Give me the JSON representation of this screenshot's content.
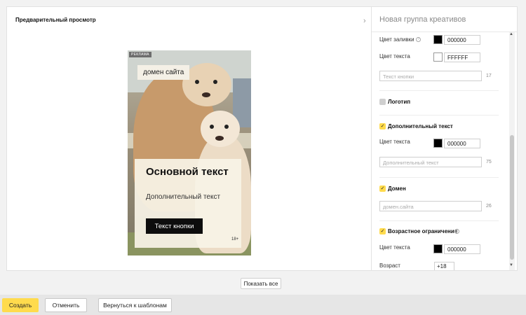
{
  "preview": {
    "title": "Предварительный просмотр",
    "collapse_icon": "chevron-right-icon",
    "ad": {
      "badge": "РЕКЛАМА",
      "domain": "домен сайта",
      "main_text": "Основной текст",
      "extra_text": "Дополнительный текст",
      "button_text": "Текст кнопки",
      "age": "18+"
    },
    "show_all": "Показать все"
  },
  "settings": {
    "title": "Новая группа креативов",
    "fill_color": {
      "label": "Цвет заливки",
      "value": "000000",
      "swatch": "#000000"
    },
    "text_color": {
      "label": "Цвет текста",
      "value": "FFFFFF",
      "swatch": "#ffffff"
    },
    "button_text": {
      "placeholder": "Текст кнопки",
      "counter": "17"
    },
    "logo": {
      "label": "Логотип",
      "checked": false
    },
    "extra_text": {
      "label": "Дополнительный текст",
      "checked": true,
      "color_label": "Цвет текста",
      "color_value": "000000",
      "swatch": "#000000",
      "placeholder": "Дополнительный текст",
      "counter": "75"
    },
    "domain": {
      "label": "Домен",
      "checked": true,
      "placeholder": "домен.сайта",
      "counter": "26"
    },
    "age_limit": {
      "label": "Возрастное ограничение",
      "checked": true,
      "color_label": "Цвет текста",
      "color_value": "000000",
      "swatch": "#000000",
      "age_label": "Возраст",
      "age_value": "+18"
    }
  },
  "actions": {
    "create": "Создать",
    "cancel": "Отменить",
    "back": "Вернуться к шаблонам"
  },
  "colors": {
    "accent": "#ffdb4d"
  }
}
